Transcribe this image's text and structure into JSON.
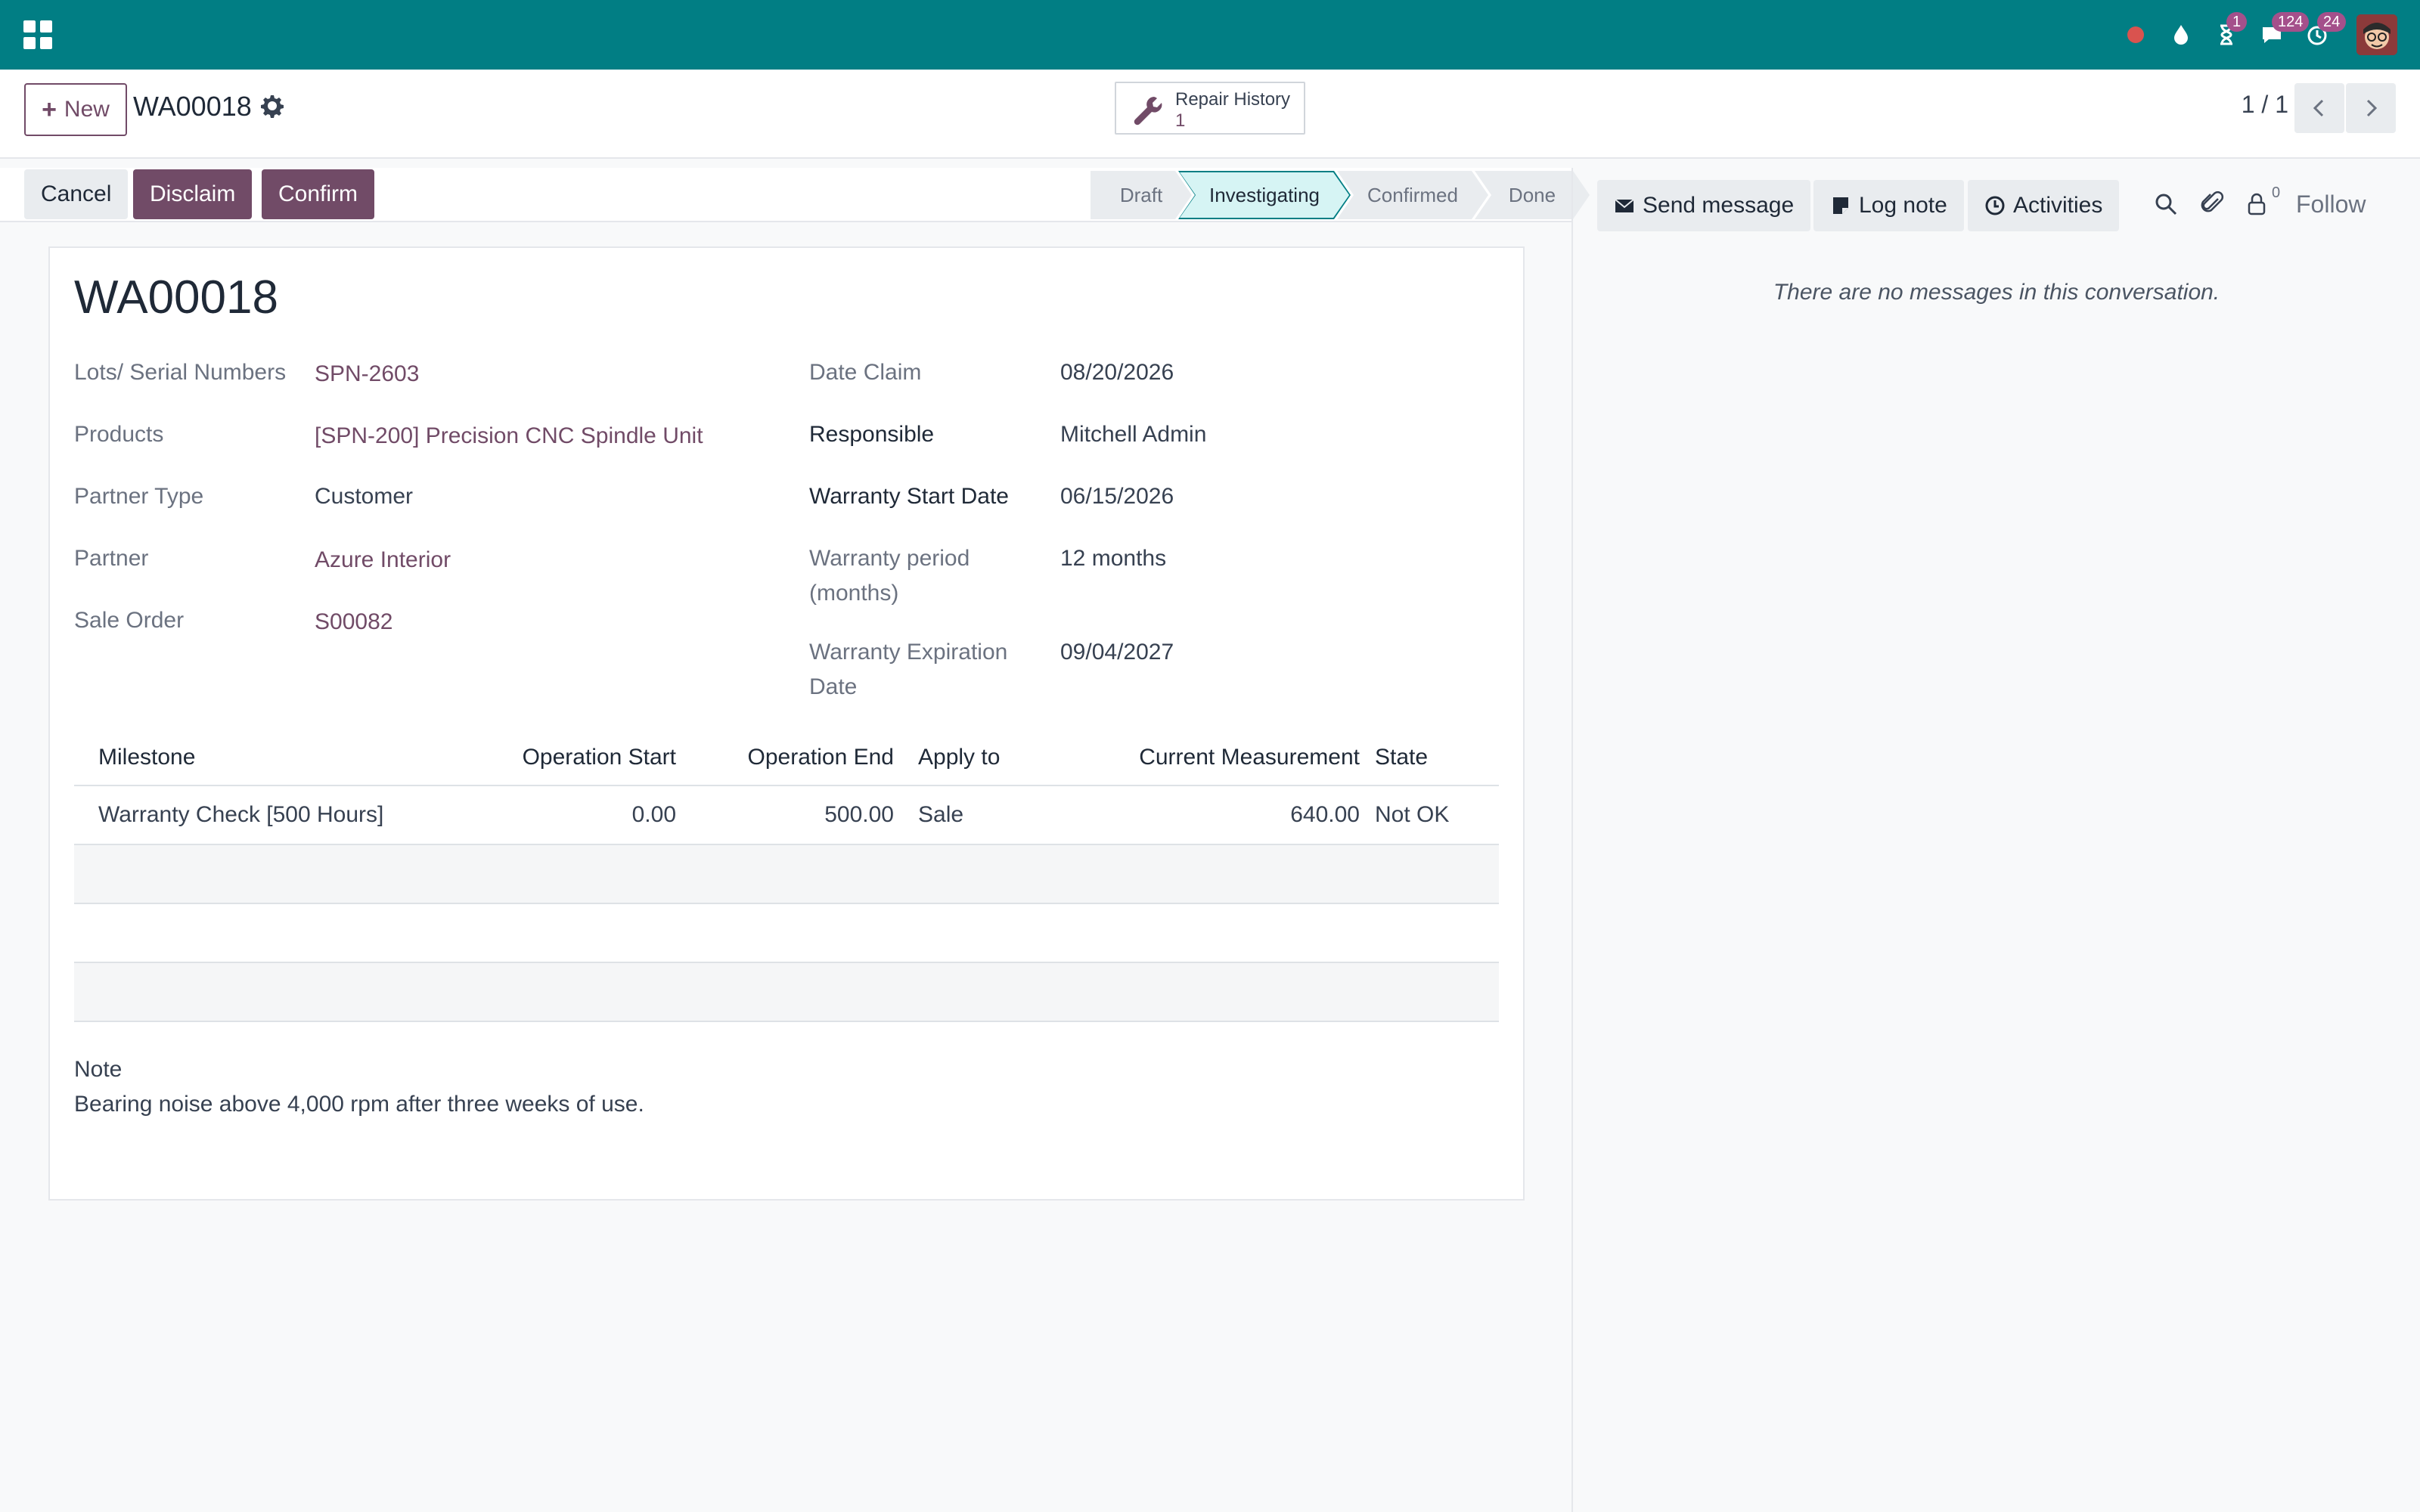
{
  "navbar": {
    "apps_icon": "apps-grid-icon",
    "activity_count": "1",
    "messages_count": "124",
    "timer_count": "24"
  },
  "control_panel": {
    "new_label": "New",
    "record_title": "WA00018",
    "smart_button": {
      "label": "Repair History",
      "value": "1"
    },
    "pager": "1 / 1"
  },
  "status_bar": {
    "cancel_label": "Cancel",
    "disclaim_label": "Disclaim",
    "confirm_label": "Confirm",
    "stages": [
      "Draft",
      "Investigating",
      "Confirmed",
      "Done"
    ],
    "active_stage": "Investigating"
  },
  "form": {
    "title": "WA00018",
    "left_fields": [
      {
        "label": "Lots/ Serial Numbers",
        "value": "SPN-2603"
      },
      {
        "label": "Products",
        "value": "[SPN-200] Precision CNC Spindle Unit"
      },
      {
        "label": "Partner Type",
        "value": "Customer"
      },
      {
        "label": "Partner",
        "value": "Azure Interior"
      },
      {
        "label": "Sale Order",
        "value": "S00082"
      }
    ],
    "right_fields": [
      {
        "label": "Date Claim",
        "value": "08/20/2026"
      },
      {
        "label": "Responsible",
        "value": "Mitchell Admin"
      },
      {
        "label": "Warranty Start Date",
        "value": "06/15/2026"
      },
      {
        "label_line1": "Warranty period",
        "label_line2": "(months)",
        "value": "12 months"
      },
      {
        "label_line1": "Warranty Expiration",
        "label_line2": "Date",
        "value": "09/04/2027"
      }
    ],
    "table": {
      "headers": [
        "Milestone",
        "Operation Start",
        "Operation End",
        "Apply to",
        "Current Measurement",
        "State"
      ],
      "rows": [
        [
          "Warranty Check [500 Hours]",
          "0.00",
          "500.00",
          "Sale",
          "640.00",
          "Not OK"
        ]
      ]
    },
    "note_label": "Note",
    "note_text": "Bearing noise above 4,000 rpm after three weeks of use."
  },
  "chatter": {
    "send_message_label": "Send message",
    "log_note_label": "Log note",
    "activities_label": "Activities",
    "follower_count": "0",
    "follow_label": "Follow",
    "empty_text": "There are no messages in this conversation."
  }
}
